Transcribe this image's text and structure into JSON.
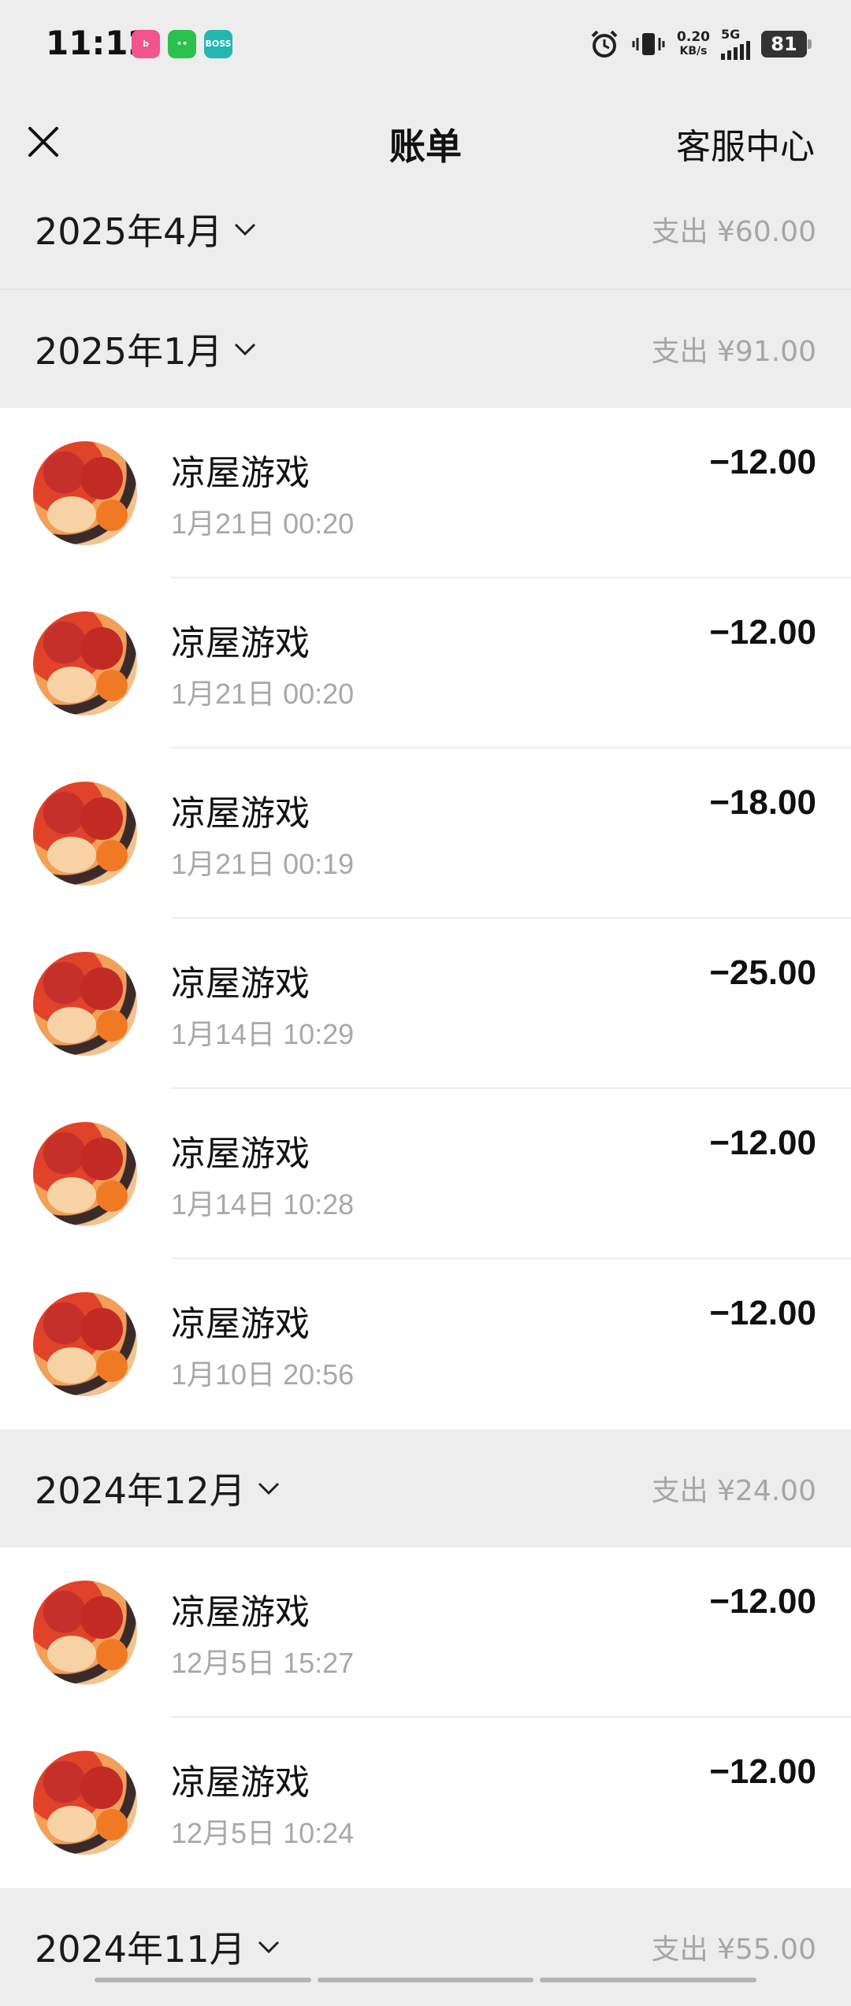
{
  "status_bar": {
    "time": "11:12",
    "apps": [
      "bilibili",
      "wechat",
      "BOSS直聘"
    ],
    "net_speed": "0.20",
    "net_unit": "KB/s",
    "signal_label": "5G",
    "battery": "81"
  },
  "nav": {
    "title": "账单",
    "right_label": "客服中心"
  },
  "months": [
    {
      "label": "2025年4月",
      "total": "支出 ¥60.00",
      "items": []
    },
    {
      "label": "2025年1月",
      "total": "支出 ¥91.00",
      "items": [
        {
          "merchant": "凉屋游戏",
          "time": "1月21日 00:20",
          "amount": "−12.00"
        },
        {
          "merchant": "凉屋游戏",
          "time": "1月21日 00:20",
          "amount": "−12.00"
        },
        {
          "merchant": "凉屋游戏",
          "time": "1月21日 00:19",
          "amount": "−18.00"
        },
        {
          "merchant": "凉屋游戏",
          "time": "1月14日 10:29",
          "amount": "−25.00"
        },
        {
          "merchant": "凉屋游戏",
          "time": "1月14日 10:28",
          "amount": "−12.00"
        },
        {
          "merchant": "凉屋游戏",
          "time": "1月10日 20:56",
          "amount": "−12.00"
        }
      ]
    },
    {
      "label": "2024年12月",
      "total": "支出 ¥24.00",
      "items": [
        {
          "merchant": "凉屋游戏",
          "time": "12月5日 15:27",
          "amount": "−12.00"
        },
        {
          "merchant": "凉屋游戏",
          "time": "12月5日 10:24",
          "amount": "−12.00"
        }
      ]
    },
    {
      "label": "2024年11月",
      "total": "支出 ¥55.00",
      "items": []
    }
  ],
  "colors": {
    "background": "#ededed",
    "card": "#ffffff",
    "muted_text": "#a8a8a8"
  }
}
